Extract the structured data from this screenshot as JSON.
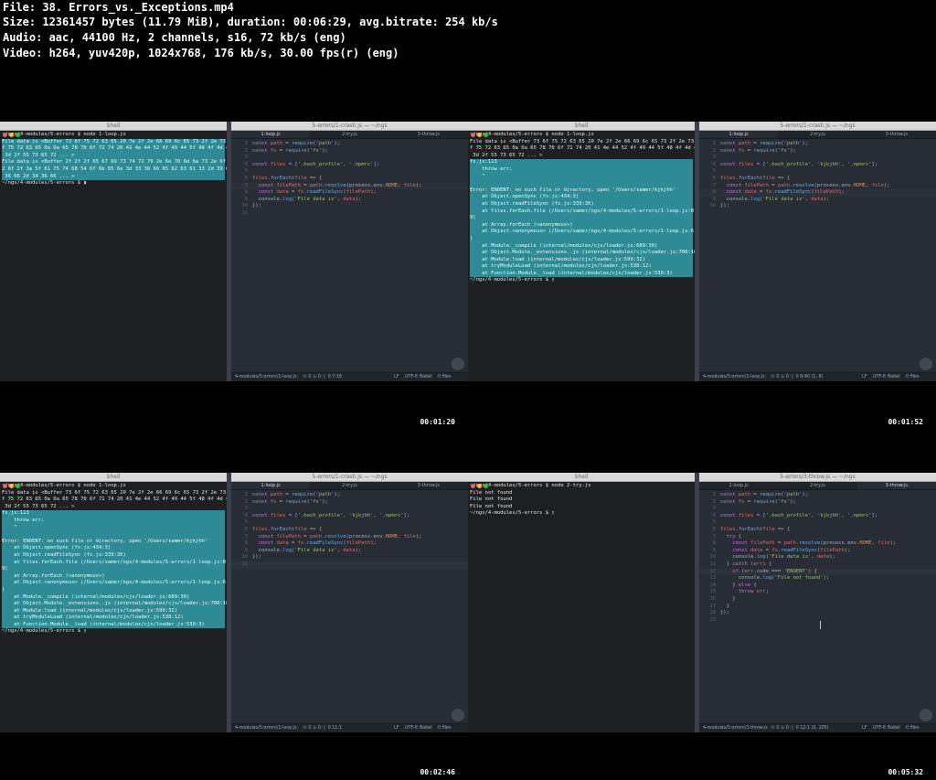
{
  "header": [
    "File: 38. Errors_vs._Exceptions.mp4",
    "Size: 12361457 bytes (11.79 MiB), duration: 00:06:29, avg.bitrate: 254 kb/s",
    "Audio: aac, 44100 Hz, 2 channels, s16, 72 kb/s (eng)",
    "Video: h264, yuv420p, 1024x768, 176 kb/s, 30.00 fps(r) (eng)"
  ],
  "colors": {
    "term_highlight": "#2e8a94",
    "editor_bg": "#282c34",
    "shell_bg": "#1d1f21"
  },
  "frames": [
    {
      "timestamp": "00:01:20",
      "shell": {
        "title": "Shell",
        "lines": [
          {
            "t": "~/ngs/4-modules/5-errors $ node 1-loop.js",
            "hl": false
          },
          {
            "t": "File data is <Buffer 73 6f 75 72 63 65 20 7e 2f 2e 66 69 6c 65 73 2f 2e 73 6",
            "hl": true
          },
          {
            "t": "f 75 72 63 65 0a 0a 65 78 70 6f 72 74 20 41 4e 44 52 4f 49 44 5f 48 4f 4d 45",
            "hl": true
          },
          {
            "t": " 3d 2f 55 73 65 72 ... >",
            "hl": true
          },
          {
            "t": "File data is <Buffer 2f 2f 2f 65 67 69 73 74 72 79 2e 6e 70 6d 6a 73 2e 6f 7",
            "hl": true
          },
          {
            "t": "2 6f 2f 3a 5f 61 75 74 68 54 6f 6b 65 6e 3d 33 30 66 65 62 63 61 33 2d 39 65",
            "hl": true
          },
          {
            "t": " 36 66 2d 34 36 66 ... >",
            "hl": true
          },
          {
            "t": "~/ngs/4-modules/5-errors $ ▮",
            "hl": false
          }
        ]
      },
      "editor": {
        "title": "5-errors/1-crash.js — ~/ngs",
        "tabs": [
          "1-loop.js",
          "2-try.js",
          "3-throw.js"
        ],
        "active_tab": 0,
        "current_line": 7,
        "code": [
          [
            "kw:const ",
            "var:path",
            " = ",
            "fn:require",
            "(",
            "str:'path'",
            ");"
          ],
          [
            "kw:const ",
            "var:fs",
            " = ",
            "fn:require",
            "(",
            "str:'fs'",
            ");"
          ],
          [],
          [
            "kw:const ",
            "var:files",
            " = [",
            "str:'.bash_profile'",
            ", ",
            "str:'.npmrc'",
            "];"
          ],
          [],
          [
            "var:files",
            ".",
            "fn:forEach",
            "(",
            "var:file",
            " => {"
          ],
          [
            "  ",
            "kw:const ",
            "var:filePath",
            " = ",
            "var:path",
            ".",
            "fn:resolve",
            "(process.env.",
            "num:HOME",
            ", ",
            "var:file",
            ");"
          ],
          [
            "  ",
            "kw:const ",
            "var:data",
            " = ",
            "var:fs",
            ".",
            "fn:readFileSync",
            "(",
            "var:filePath",
            ");"
          ],
          [
            "  console.",
            "fn:log",
            "(",
            "str:'File data is'",
            ", ",
            "var:data",
            ");"
          ],
          [
            "});"
          ],
          []
        ],
        "status_left": "4-modules/5-errors/1-loop.js",
        "status_mid": "⓪ 0 ⚠ 0 ⓘ 0   7:18",
        "status_right": [
          "LF",
          "UTF-8",
          "Babel",
          "0 files"
        ]
      }
    },
    {
      "timestamp": "00:01:52",
      "shell": {
        "title": "Shell",
        "lines": [
          {
            "t": "~/ngs/4-modules/5-errors $ node 1-loop.js",
            "hl": false
          },
          {
            "t": "File data is <Buffer 73 6f 75 72 63 65 20 7e 2f 2e 66 69 6c 65 73 2f 2e 73 6",
            "hl": false
          },
          {
            "t": "f 75 72 63 65 0a 0a 65 78 70 6f 72 74 20 41 4e 44 52 4f 49 44 5f 48 4f 4d 45",
            "hl": false
          },
          {
            "t": " 3d 2f 55 73 65 72 ... >",
            "hl": false
          },
          {
            "t": "fs.js:113",
            "hl": true
          },
          {
            "t": "    throw err;",
            "hl": true
          },
          {
            "t": "    ^",
            "hl": true
          },
          {
            "t": "",
            "hl": true
          },
          {
            "t": "Error: ENOENT: no such file or directory, open '/Users/samer/kjkjhh'",
            "hl": true
          },
          {
            "t": "    at Object.openSync (fs.js:434:3)",
            "hl": true
          },
          {
            "t": "    at Object.readFileSync (fs.js:339:35)",
            "hl": true
          },
          {
            "t": "    at files.forEach.file (/Users/samer/ngs/4-modules/5-errors/1-loop.js:8:1",
            "hl": true
          },
          {
            "t": "9)",
            "hl": true
          },
          {
            "t": "    at Array.forEach (<anonymous>)",
            "hl": true
          },
          {
            "t": "    at Object.<anonymous> (/Users/samer/ngs/4-modules/5-errors/1-loop.js:6:7",
            "hl": true
          },
          {
            "t": ")",
            "hl": true
          },
          {
            "t": "    at Module._compile (internal/modules/cjs/loader.js:689:30)",
            "hl": true
          },
          {
            "t": "    at Object.Module._extensions..js (internal/modules/cjs/loader.js:700:10)",
            "hl": true
          },
          {
            "t": "    at Module.load (internal/modules/cjs/loader.js:599:32)",
            "hl": true
          },
          {
            "t": "    at tryModuleLoad (internal/modules/cjs/loader.js:538:12)",
            "hl": true
          },
          {
            "t": "    at Function.Module._load (internal/modules/cjs/loader.js:530:3)",
            "hl": true
          },
          {
            "t": "~/ngs/4-modules/5-errors $ ▯",
            "hl": false
          }
        ]
      },
      "editor": {
        "title": "5-errors/1-crash.js — ~/ngs",
        "tabs": [
          "1-loop.js",
          "2-try.js",
          "3-throw.js"
        ],
        "active_tab": 0,
        "current_line": 8,
        "code": [
          [
            "kw:const ",
            "var:path",
            " = ",
            "fn:require",
            "(",
            "str:'path'",
            ");"
          ],
          [
            "kw:const ",
            "var:fs",
            " = ",
            "fn:require",
            "(",
            "str:'fs'",
            ");"
          ],
          [],
          [
            "kw:const ",
            "var:files",
            " = [",
            "str:'.bash_profile'",
            ", ",
            "str:'kjkjhh'",
            ", ",
            "str:'.npmrc'",
            "];"
          ],
          [],
          [
            "var:files",
            ".",
            "fn:forEach",
            "(",
            "var:file",
            " => {"
          ],
          [
            "  ",
            "kw:const ",
            "var:filePath",
            " = ",
            "var:path",
            ".",
            "fn:resolve",
            "(process.env.",
            "num:HOME",
            ", ",
            "var:file",
            ");"
          ],
          [
            "  ",
            "kw:const ",
            "var:data",
            " = ",
            "var:fs",
            ".",
            "fn:readFileSync",
            "(",
            "var:filePath",
            ");"
          ],
          [
            "  console.",
            "fn:log",
            "(",
            "str:'File data is'",
            ", ",
            "var:data",
            ");"
          ],
          [
            "});"
          ]
        ],
        "status_left": "4-modules/5-errors/1-loop.js",
        "status_mid": "⓪ 0 ⚠ 0 ⓘ 0   8:40   (1, 8)",
        "status_right": [
          "LF",
          "UTF-8",
          "Babel",
          "0 files"
        ]
      }
    },
    {
      "timestamp": "00:02:46",
      "shell": {
        "title": "Shell",
        "lines": [
          {
            "t": "~/ngs/4-modules/5-errors $ node 1-loop.js",
            "hl": false
          },
          {
            "t": "File data is <Buffer 73 6f 75 72 63 65 20 7e 2f 2e 66 69 6c 65 73 2f 2e 73 6",
            "hl": false
          },
          {
            "t": "f 75 72 63 65 0a 0a 65 78 70 6f 72 74 20 41 4e 44 52 4f 49 44 5f 48 4f 4d 45",
            "hl": false
          },
          {
            "t": " 3d 2f 55 73 65 72 ... >",
            "hl": false
          },
          {
            "t": "fs.js:113",
            "hl": true
          },
          {
            "t": "    throw err;",
            "hl": true
          },
          {
            "t": "    ^",
            "hl": true
          },
          {
            "t": "",
            "hl": true
          },
          {
            "t": "Error: ENOENT: no such file or directory, open '/Users/samer/kjkjhh'",
            "hl": true
          },
          {
            "t": "    at Object.openSync (fs.js:434:3)",
            "hl": true
          },
          {
            "t": "    at Object.readFileSync (fs.js:339:35)",
            "hl": true
          },
          {
            "t": "    at files.forEach.file (/Users/samer/ngs/4-modules/5-errors/1-loop.js:8:1",
            "hl": true
          },
          {
            "t": "9)",
            "hl": true
          },
          {
            "t": "    at Array.forEach (<anonymous>)",
            "hl": true
          },
          {
            "t": "    at Object.<anonymous> (/Users/samer/ngs/4-modules/5-errors/1-loop.js:6:7",
            "hl": true
          },
          {
            "t": ")",
            "hl": true
          },
          {
            "t": "    at Module._compile (internal/modules/cjs/loader.js:689:30)",
            "hl": true
          },
          {
            "t": "    at Object.Module._extensions..js (internal/modules/cjs/loader.js:700:10)",
            "hl": true
          },
          {
            "t": "    at Module.load (internal/modules/cjs/loader.js:599:32)",
            "hl": true
          },
          {
            "t": "    at tryModuleLoad (internal/modules/cjs/loader.js:538:12)",
            "hl": true
          },
          {
            "t": "    at Function.Module._load (internal/modules/cjs/loader.js:530:3)",
            "hl": true
          },
          {
            "t": "~/ngs/4-modules/5-errors $ ▯",
            "hl": false
          }
        ]
      },
      "editor": {
        "title": "5-errors/1-crash.js — ~/ngs",
        "tabs": [
          "1-loop.js",
          "2-try.js",
          "3-throw.js"
        ],
        "active_tab": 0,
        "current_line": 11,
        "code": [
          [
            "kw:const ",
            "var:path",
            " = ",
            "fn:require",
            "(",
            "str:'path'",
            ");"
          ],
          [
            "kw:const ",
            "var:fs",
            " = ",
            "fn:require",
            "(",
            "str:'fs'",
            ");"
          ],
          [],
          [
            "kw:const ",
            "var:files",
            " = [",
            "str:'.bash_profile'",
            ", ",
            "str:'kjkjhh'",
            ", ",
            "str:'.npmrc'",
            "];"
          ],
          [],
          [
            "var:files",
            ".",
            "fn:forEach",
            "(",
            "var:file",
            " => {"
          ],
          [
            "  ",
            "kw:const ",
            "var:filePath",
            " = ",
            "var:path",
            ".",
            "fn:resolve",
            "(process.env.",
            "num:HOME",
            ", ",
            "var:file",
            ");"
          ],
          [
            "  ",
            "kw:const ",
            "var:data",
            " = ",
            "var:fs",
            ".",
            "fn:readFileSync",
            "(",
            "var:filePath",
            ");"
          ],
          [
            "  console.",
            "fn:log",
            "(",
            "str:'File data is'",
            ", ",
            "var:data",
            ");"
          ],
          [
            "});"
          ],
          []
        ],
        "status_left": "4-modules/5-errors/1-loop.js",
        "status_mid": "⓪ 0 ⚠ 0 ⓘ 0   11:1",
        "status_right": [
          "LF",
          "UTF-8",
          "Babel",
          "0 files"
        ]
      }
    },
    {
      "timestamp": "00:05:32",
      "shell": {
        "title": "Shell",
        "lines": [
          {
            "t": "~/ngs/4-modules/5-errors $ node 2-try.js",
            "hl": false
          },
          {
            "t": "File not found",
            "hl": false
          },
          {
            "t": "File not found",
            "hl": false
          },
          {
            "t": "File not found",
            "hl": false
          },
          {
            "t": "~/ngs/4-modules/5-errors $ ▯",
            "hl": false
          }
        ]
      },
      "editor": {
        "title": "5-errors/3-throw.js — ~/ngs",
        "tabs": [
          "1-loop.js",
          "2-try.js",
          "3-throw.js"
        ],
        "active_tab": 2,
        "current_line": 12,
        "code": [
          [
            "kw:const ",
            "var:path",
            " = ",
            "fn:require",
            "(",
            "str:'path'",
            ");"
          ],
          [
            "kw:const ",
            "var:fs",
            " = ",
            "fn:require",
            "(",
            "str:'fs'",
            ");"
          ],
          [],
          [
            "kw:const ",
            "var:files",
            " = [",
            "str:'.bash_profile'",
            ", ",
            "str:'kjkjhh'",
            ", ",
            "str:'.npmrc'",
            "];"
          ],
          [],
          [
            "var:files",
            ".",
            "fn:forEach",
            "(",
            "var:file",
            " => {"
          ],
          [
            "  ",
            "kw:try",
            " {"
          ],
          [
            "    ",
            "kw:const ",
            "var:filePath",
            " = ",
            "var:path",
            ".",
            "fn:resolve",
            "(process.env.",
            "num:HOME",
            ", ",
            "var:file",
            ");"
          ],
          [
            "    ",
            "kw:const ",
            "var:data",
            " = ",
            "var:fs",
            ".",
            "fn:readFileSync",
            "(",
            "var:filePath",
            ");"
          ],
          [
            "    console.",
            "fn:log",
            "(",
            "str:'File data is'",
            ", ",
            "var:data",
            ");"
          ],
          [
            "  } ",
            "kw:catch",
            " (",
            "var:err",
            ") {"
          ],
          [
            "    ",
            "kw:if",
            " (",
            "var:err",
            ".code === ",
            "str:'ENOENT'",
            ") {"
          ],
          [
            "      console.",
            "fn:log",
            "(",
            "str:'File not found'",
            ");"
          ],
          [
            "    } ",
            "kw:else",
            " {"
          ],
          [
            "      ",
            "kw:throw ",
            "var:err",
            ";"
          ],
          [
            "    }"
          ],
          [
            "  }"
          ],
          [
            "});"
          ],
          []
        ],
        "status_left": "4-modules/5-errors/3-throw.js",
        "status_mid": "⓪ 0 ⚠ 0 ⓘ 0   12:1   (0, 105)",
        "status_right": [
          "LF",
          "UTF-8",
          "Babel",
          "0 files"
        ]
      }
    }
  ]
}
